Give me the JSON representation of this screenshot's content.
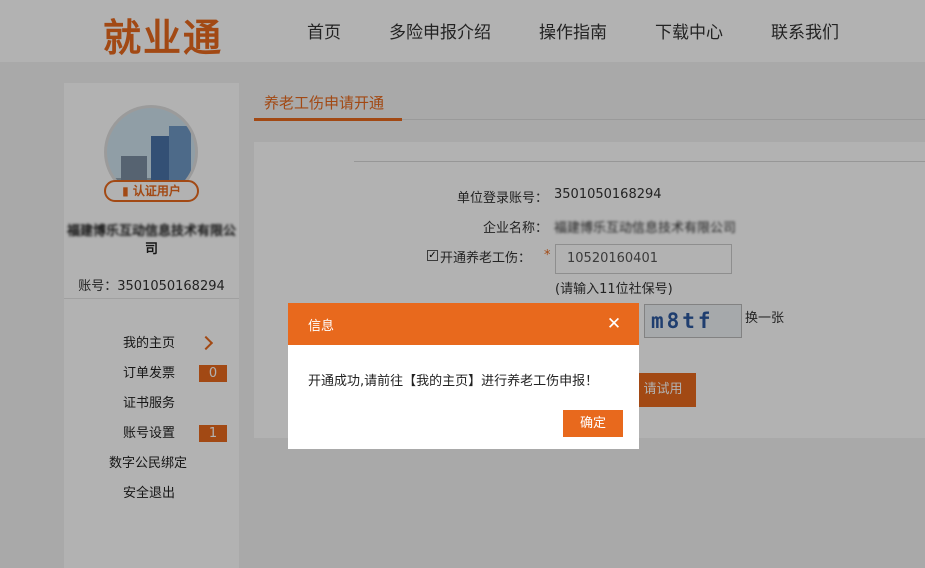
{
  "header": {
    "logo": "就业通",
    "nav": [
      "首页",
      "多险申报介绍",
      "操作指南",
      "下载中心",
      "联系我们"
    ]
  },
  "sidebar": {
    "cert_badge": "认证用户",
    "company_name": "福建博乐互动信息技术有限公",
    "company_tail": "司",
    "account": "账号：3501050168294",
    "menu": [
      {
        "label": "我的主页"
      },
      {
        "label": "订单发票",
        "badge": "0"
      },
      {
        "label": "证书服务"
      },
      {
        "label": "账号设置",
        "badge": "1"
      },
      {
        "label": "数字公民绑定"
      },
      {
        "label": "安全退出"
      }
    ]
  },
  "main": {
    "tab_title": "养老工伤申请开通",
    "form": {
      "login_label": "单位登录账号：",
      "login_value": "3501050168294",
      "company_label": "企业名称：",
      "company_value": "福建博乐互动信息技术有限公司",
      "pension_label": "开通养老工伤：",
      "required_mark": "*",
      "pension_value": "10520160401",
      "hint": "(请输入11位社保号)",
      "captcha_text": "m8tf",
      "refresh_label": "换一张",
      "submit_label": "请试用"
    }
  },
  "dialog": {
    "title": "信息",
    "close_glyph": "✕",
    "message": "开通成功,请前往【我的主页】进行养老工伤申报！",
    "ok_label": "确定"
  },
  "colors": {
    "accent": "#e8691d"
  }
}
